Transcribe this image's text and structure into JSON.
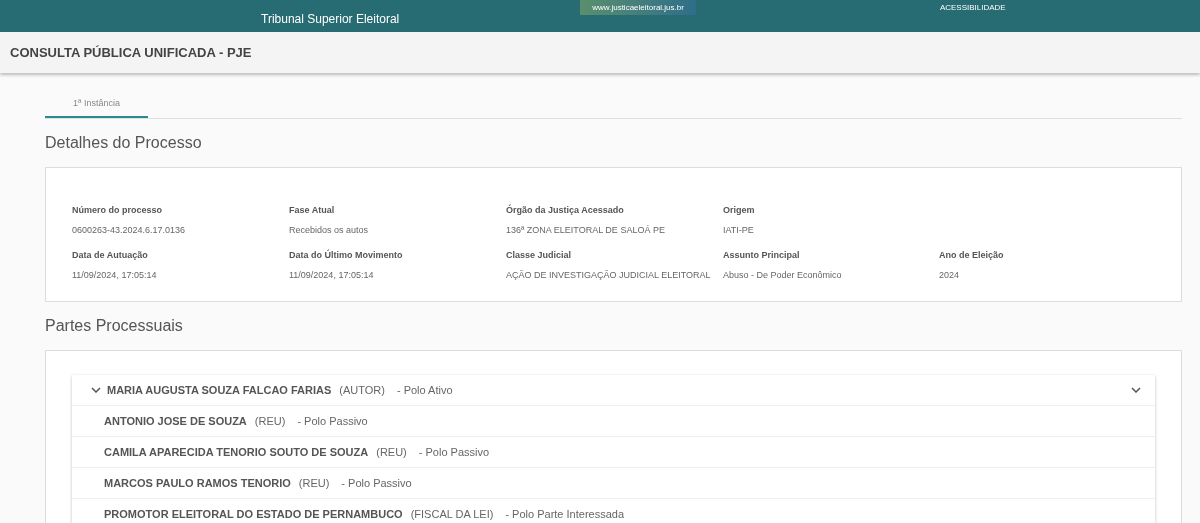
{
  "header": {
    "org_name": "Tribunal Superior Eleitoral",
    "url_badge": "www.justicaeleitoral.jus.br",
    "accessibility_link": "ACESSIBILIDADE"
  },
  "title_bar": {
    "title": "CONSULTA PÚBLICA UNIFICADA - PJE"
  },
  "tabs": [
    {
      "label": "1ª Instância",
      "selected": true
    }
  ],
  "details": {
    "heading": "Detalhes do Processo",
    "rows": [
      [
        {
          "label": "Número do processo",
          "value": "0600263-43.2024.6.17.0136"
        },
        {
          "label": "Fase Atual",
          "value": "Recebidos os autos"
        },
        {
          "label": "Órgão da Justiça Acessado",
          "value": "136ª ZONA ELEITORAL DE SALOÁ PE"
        },
        {
          "label": "Origem",
          "value": "IATI-PE"
        }
      ],
      [
        {
          "label": "Data de Autuação",
          "value": "11/09/2024, 17:05:14"
        },
        {
          "label": "Data do Último Movimento",
          "value": "11/09/2024, 17:05:14"
        },
        {
          "label": "Classe Judicial",
          "value": "AÇÃO DE INVESTIGAÇÃO JUDICIAL ELEITORAL"
        },
        {
          "label": "Assunto Principal",
          "value": "Abuso - De Poder Econômico"
        },
        {
          "label": "Ano de Eleição",
          "value": "2024"
        }
      ]
    ]
  },
  "parties": {
    "heading": "Partes Processuais",
    "panel": {
      "expanded": true,
      "name": "MARIA AUGUSTA SOUZA FALCAO FARIAS",
      "role": "(AUTOR)",
      "pole": "- Polo Ativo",
      "children": [
        {
          "name": "ANTONIO JOSE DE SOUZA",
          "role": "(REU)",
          "pole": "- Polo Passivo"
        },
        {
          "name": "CAMILA APARECIDA TENORIO SOUTO DE SOUZA",
          "role": "(REU)",
          "pole": "- Polo Passivo"
        },
        {
          "name": "MARCOS PAULO RAMOS TENORIO",
          "role": "(REU)",
          "pole": "- Polo Passivo"
        },
        {
          "name": "PROMOTOR ELEITORAL DO ESTADO DE PERNAMBUCO",
          "role": "(FISCAL DA LEI)",
          "pole": "- Polo Parte Interessada"
        }
      ]
    }
  }
}
